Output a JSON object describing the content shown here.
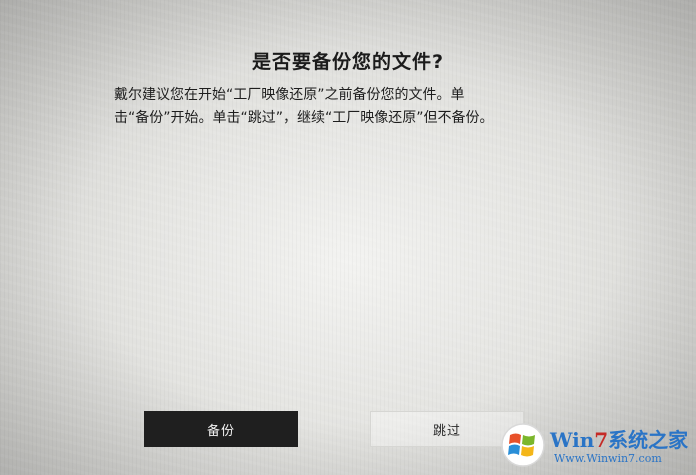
{
  "dialog": {
    "title": "是否要备份您的文件?",
    "message_lines": [
      "戴尔建议您在开始“工厂映像还原”之前备份您的文件。单",
      "击“备份”开始。单击“跳过”，继续“工厂映像还原”但不备份。"
    ]
  },
  "buttons": {
    "backup_label": "备份",
    "skip_label": "跳过"
  },
  "watermark": {
    "brand_prefix": "Win",
    "brand_seven": "7",
    "brand_cn": "系统之家",
    "url": "Www.Winwin7.com"
  },
  "colors": {
    "backup_button_bg": "#1f1f1f",
    "backup_button_text": "#f2f2f2",
    "watermark_blue": "#2a74c6",
    "watermark_red": "#c52a26"
  }
}
